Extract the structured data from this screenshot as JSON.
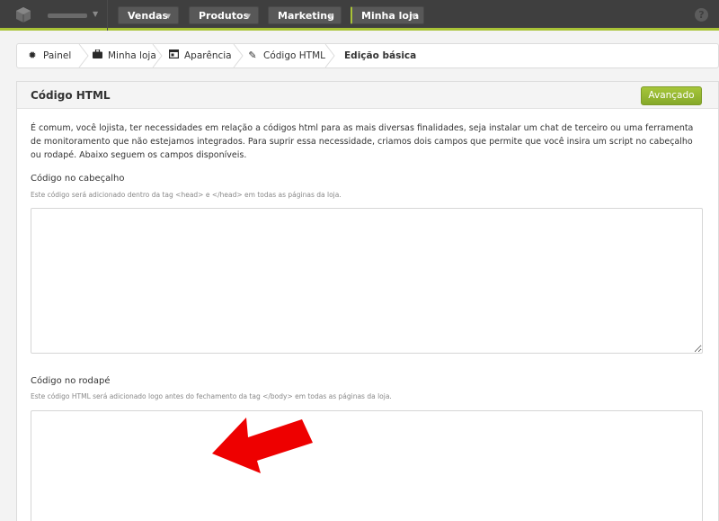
{
  "topbar": {
    "nav": [
      {
        "label": "Vendas"
      },
      {
        "label": "Produtos"
      },
      {
        "label": "Marketing"
      },
      {
        "label": "Minha loja"
      }
    ],
    "help_label": "?",
    "accent_color": "#a9c337"
  },
  "breadcrumb": [
    {
      "label": "Painel",
      "icon": "gear-icon"
    },
    {
      "label": "Minha loja",
      "icon": "briefcase-icon"
    },
    {
      "label": "Aparência",
      "icon": "window-icon"
    },
    {
      "label": "Código HTML",
      "icon": "pencil-icon"
    },
    {
      "label": "Edição básica"
    }
  ],
  "panel": {
    "title": "Código HTML",
    "advanced_button": "Avançado",
    "intro": "É comum, você lojista, ter necessidades em relação a códigos html para as mais diversas finalidades, seja instalar um chat de terceiro ou uma ferramenta de monitoramento que não estejamos integrados. Para suprir essa necessidade, criamos dois campos que permite que você insira um script no cabeçalho ou rodapé. Abaixo seguem os campos disponíveis.",
    "header_field": {
      "label": "Código no cabeçalho",
      "help": "Este código será adicionado dentro da tag <head> e </head> em todas as páginas da loja.",
      "value": ""
    },
    "footer_field": {
      "label": "Código no rodapé",
      "help": "Este código HTML será adicionado logo antes do fechamento da tag </body> em todas as páginas da loja.",
      "value": ""
    },
    "annotation_color": "#ee0000"
  }
}
